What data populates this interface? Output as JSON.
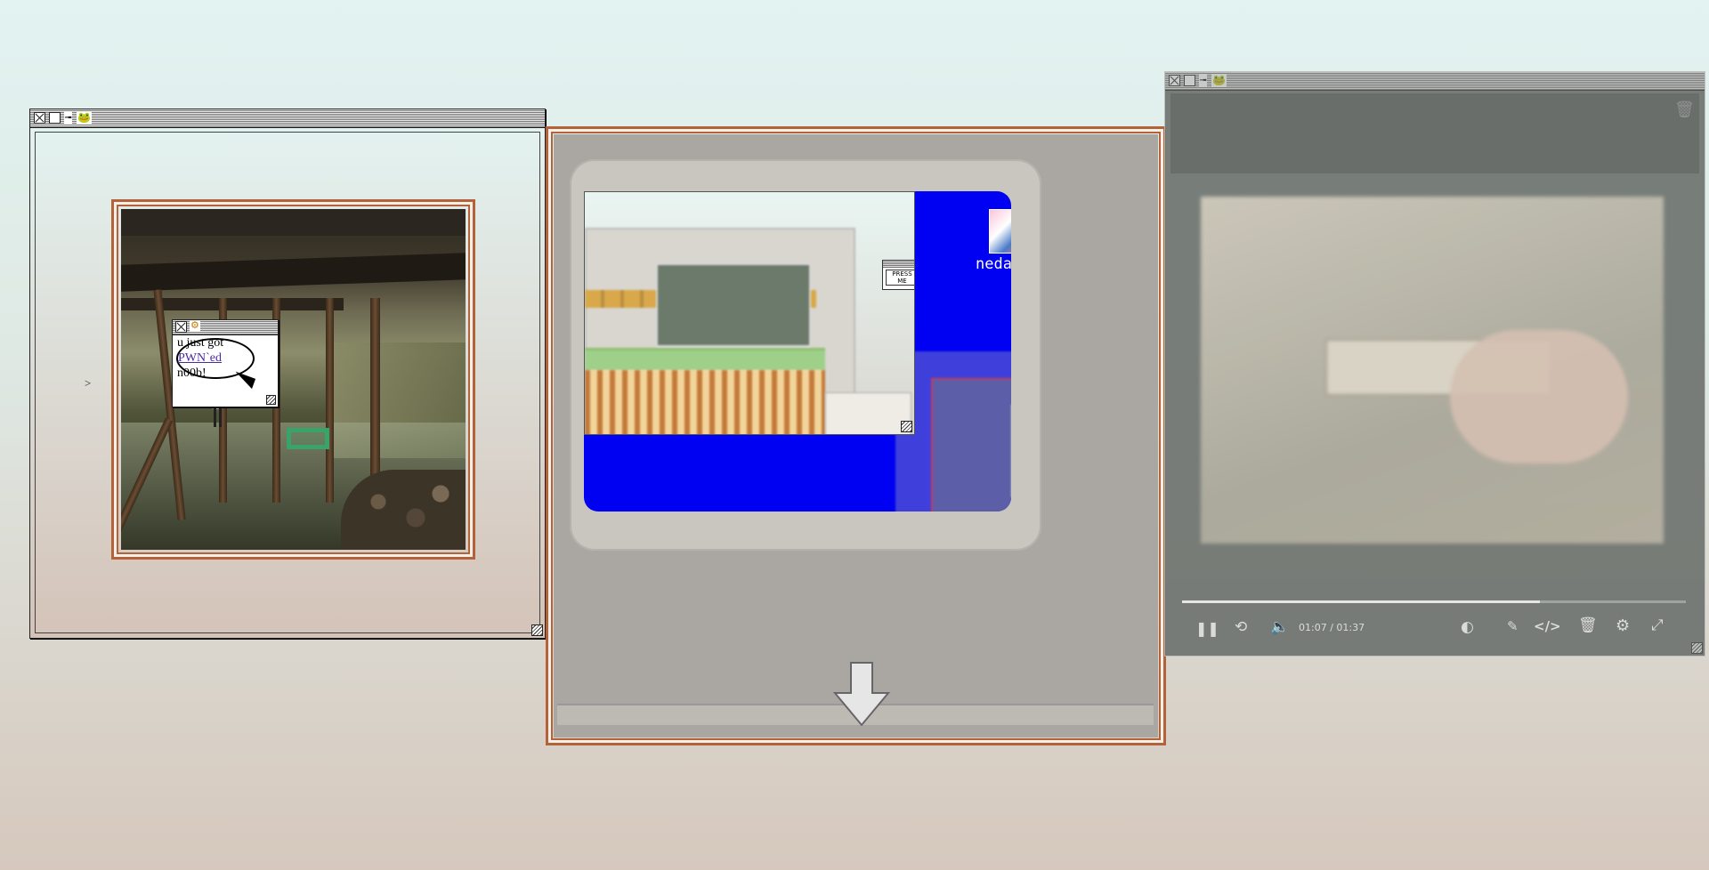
{
  "left_window": {
    "arrow_text": ">",
    "popup": {
      "line1": "u just got",
      "link": "PWN`ed",
      "line3": "n00b!"
    }
  },
  "center_monitor": {
    "desktop_label": "nedator",
    "press_button": "PRESS\nME"
  },
  "video_player": {
    "time": "01:07 / 01:37",
    "progress": 0.71
  }
}
